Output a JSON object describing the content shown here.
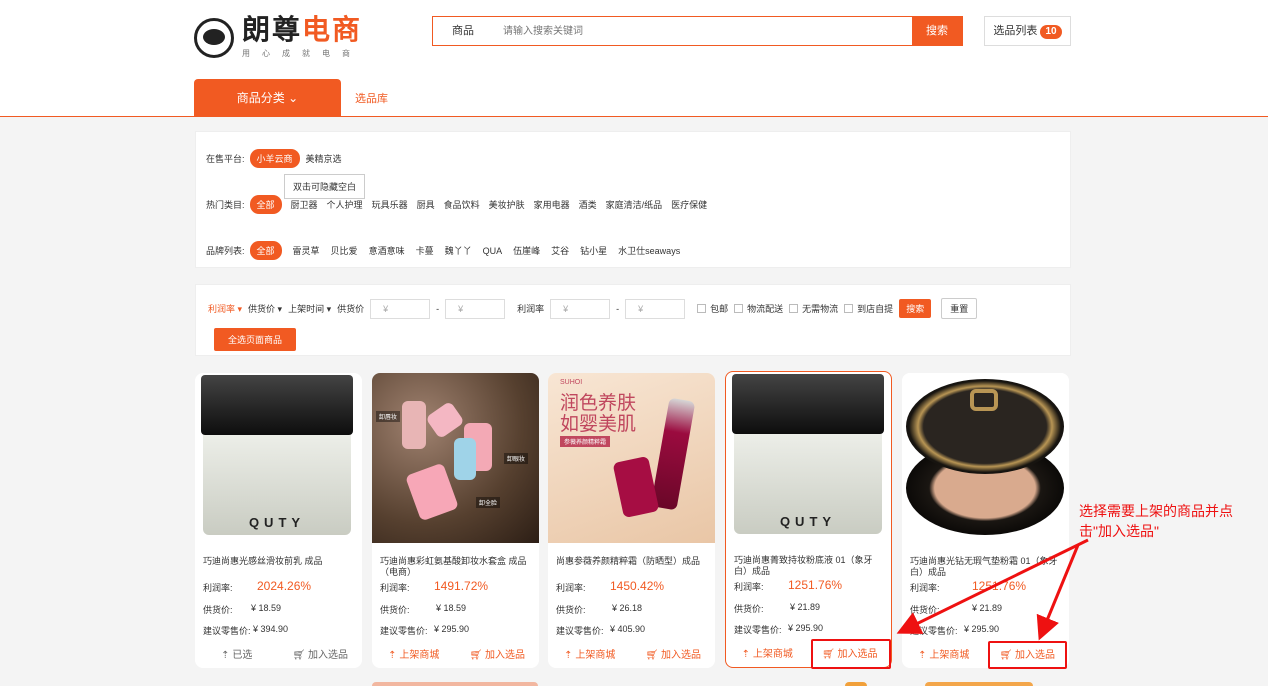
{
  "brand": {
    "title_a": "朗尊",
    "title_b": "电商",
    "slogan": "用心成就电商"
  },
  "search": {
    "category": "商品",
    "placeholder": "请输入搜索关键词",
    "button": "搜索"
  },
  "selection_list": {
    "label": "选品列表",
    "count": "10"
  },
  "nav": {
    "category_tab": "商品分类",
    "library_link": "选品库"
  },
  "filters": {
    "platform_label": "在售平台:",
    "platforms": [
      "小羊云商",
      "美精京选"
    ],
    "tooltip": "双击可隐藏空白",
    "category_label": "热门类目:",
    "categories": [
      "全部",
      "厨卫器",
      "个人护理",
      "玩具乐器",
      "厨具",
      "食品饮料",
      "美妆护肤",
      "家用电器",
      "酒类",
      "家庭清洁/纸品",
      "医疗保健"
    ],
    "brand_label": "品牌列表:",
    "brands": [
      "全部",
      "雷灵草",
      "贝比爱",
      "意酒意味",
      "卡蔓",
      "魏丫丫",
      "QUA",
      "伍崖峰",
      "艾谷",
      "钻小星",
      "水卫仕seaways"
    ]
  },
  "sort": {
    "profit": "利润率 ▾",
    "supply": "供货价 ▾",
    "listed": "上架时间 ▾",
    "supply_label": "供货价",
    "profit_label": "利润率",
    "currency": "¥",
    "dash": "-",
    "opts": [
      "包邮",
      "物流配送",
      "无需物流",
      "到店自提"
    ],
    "search_btn": "搜索",
    "reset_btn": "重置",
    "select_all": "全选页面商品"
  },
  "labels": {
    "profit": "利润率:",
    "supply": "供货价:",
    "retail": "建议零售价:",
    "listed": "已选",
    "list_mall": "上架商城",
    "add": "加入选品"
  },
  "products": [
    {
      "title": "巧迪尚惠光感丝滑妆前乳 成品",
      "profit": "2024.26%",
      "supply": "¥ 18.59",
      "retail": "¥ 394.90",
      "brand": "QUTY",
      "state": "selected"
    },
    {
      "title": "巧迪尚惠彩虹氨基酸卸妆水套盒 成品（电商）",
      "profit": "1491.72%",
      "supply": "¥ 18.59",
      "retail": "¥ 295.90",
      "state": "normal"
    },
    {
      "title": "尚惠参薇养颜精粹霜（防晒型）成品",
      "profit": "1450.42%",
      "supply": "¥ 26.18",
      "retail": "¥ 405.90",
      "state": "normal",
      "img_brand": "SUHOI",
      "img_title": "润色养肤\n如婴美肌",
      "img_band": "参薇养颜精粹霜"
    },
    {
      "title": "巧迪尚惠菁致持妆粉底液 01（象牙白）成品",
      "profit": "1251.76%",
      "supply": "¥ 21.89",
      "retail": "¥ 295.90",
      "brand": "QUTY",
      "state": "active"
    },
    {
      "title": "巧迪尚惠光钻无瑕气垫粉霜 01（象牙白）成品",
      "profit": "1251.76%",
      "supply": "¥ 21.89",
      "retail": "¥ 295.90",
      "state": "highlight"
    }
  ],
  "image_tags": {
    "t1": "卸唇妆",
    "t2": "卸眼妆",
    "t3": "卸全脸"
  },
  "annotation": "选择需要上架的商品并点击\"加入选品\"",
  "colors": {
    "accent": "#f15a22",
    "annotation": "#e11111"
  }
}
